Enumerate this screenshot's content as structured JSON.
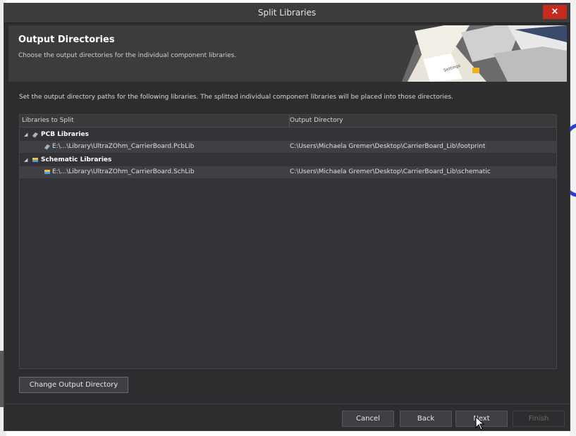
{
  "window": {
    "title": "Split Libraries",
    "close_glyph": "×"
  },
  "header": {
    "title": "Output Directories",
    "subtitle": "Choose the output directories for the individual component libraries.",
    "art_label": "Settings"
  },
  "instruction": "Set the output directory paths for the following libraries. The splitted individual component libraries will be placed into those directories.",
  "grid": {
    "columns": [
      "Libraries to Split",
      "Output Directory"
    ],
    "rows": [
      {
        "label": "PCB Libraries",
        "output": "",
        "group": true,
        "icon": "pcb-library-icon"
      },
      {
        "label": "E:\\...\\Library\\UltraZOhm_CarrierBoard.PcbLib",
        "output": "C:\\Users\\Michaela Gremer\\Desktop\\CarrierBoard_Lib\\footprint",
        "group": false,
        "icon": "pcb-library-icon"
      },
      {
        "label": "Schematic Libraries",
        "output": "",
        "group": true,
        "icon": "schematic-library-icon"
      },
      {
        "label": "E:\\...\\Library\\UltraZOhm_CarrierBoard.SchLib",
        "output": "C:\\Users\\Michaela Gremer\\Desktop\\CarrierBoard_Lib\\schematic",
        "group": false,
        "icon": "schematic-library-icon"
      }
    ]
  },
  "buttons": {
    "change_output": "Change Output Directory",
    "cancel": "Cancel",
    "back": "Back",
    "next": "Next",
    "finish": "Finish"
  },
  "colors": {
    "accent_close": "#c42b1c",
    "dialog_bg": "#2d2d30",
    "header_bg": "#3c3c3c"
  }
}
